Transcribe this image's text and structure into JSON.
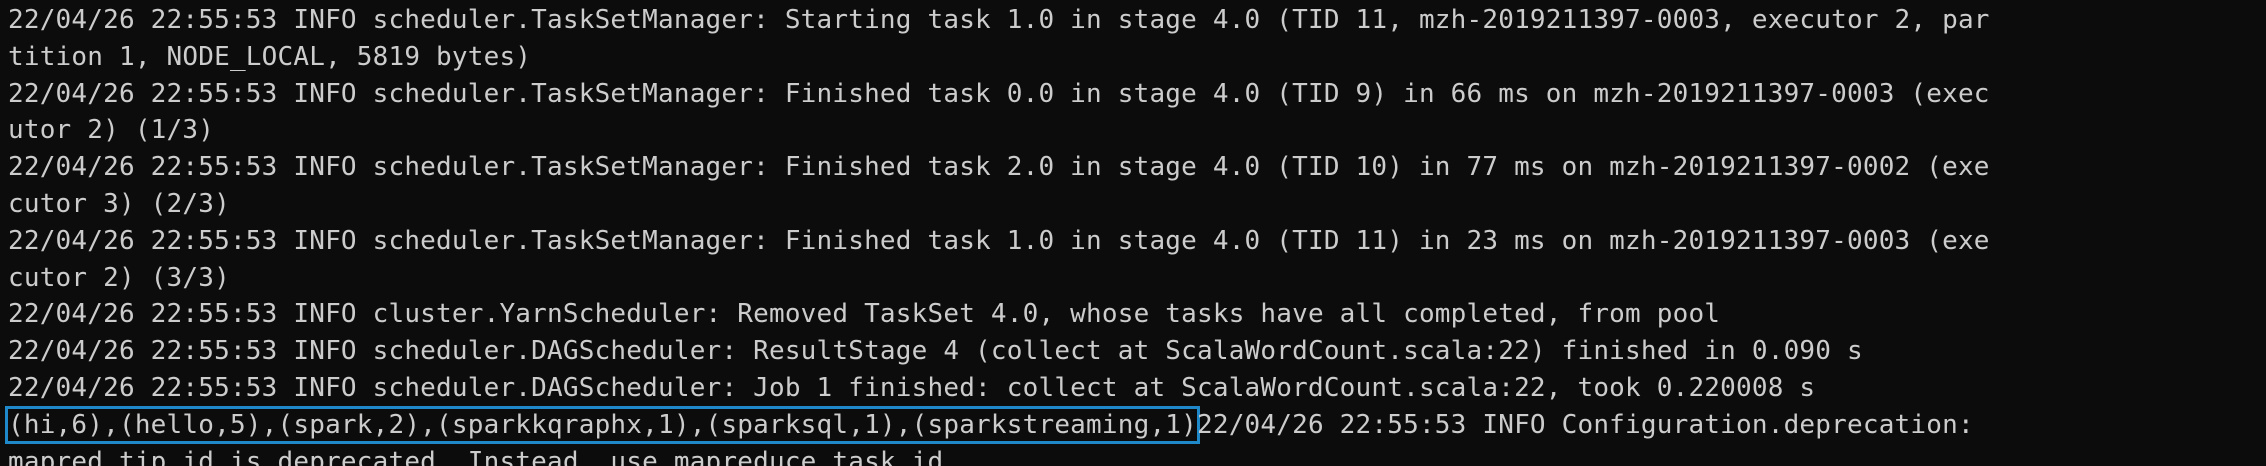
{
  "terminal": {
    "lines": [
      "22/04/26 22:55:53 INFO scheduler.TaskSetManager: Starting task 1.0 in stage 4.0 (TID 11, mzh-2019211397-0003, executor 2, par",
      "tition 1, NODE_LOCAL, 5819 bytes)",
      "22/04/26 22:55:53 INFO scheduler.TaskSetManager: Finished task 0.0 in stage 4.0 (TID 9) in 66 ms on mzh-2019211397-0003 (exec",
      "utor 2) (1/3)",
      "22/04/26 22:55:53 INFO scheduler.TaskSetManager: Finished task 2.0 in stage 4.0 (TID 10) in 77 ms on mzh-2019211397-0002 (exe",
      "cutor 3) (2/3)",
      "22/04/26 22:55:53 INFO scheduler.TaskSetManager: Finished task 1.0 in stage 4.0 (TID 11) in 23 ms on mzh-2019211397-0003 (exe",
      "cutor 2) (3/3)",
      "22/04/26 22:55:53 INFO cluster.YarnScheduler: Removed TaskSet 4.0, whose tasks have all completed, from pool",
      "22/04/26 22:55:53 INFO scheduler.DAGScheduler: ResultStage 4 (collect at ScalaWordCount.scala:22) finished in 0.090 s",
      "22/04/26 22:55:53 INFO scheduler.DAGScheduler: Job 1 finished: collect at ScalaWordCount.scala:22, took 0.220008 s"
    ],
    "result_line": {
      "highlighted": "(hi,6),(hello,5),(spark,2),(sparkkqraphx,1),(sparksql,1),(sparkstreaming,1)",
      "rest": "22/04/26 22:55:53 INFO Configuration.deprecation:"
    },
    "last_line": "mapred.tip.id is deprecated. Instead, use mapreduce.task.id",
    "colors": {
      "background": "#0c0c0c",
      "text": "#cccccc",
      "highlight_border": "#1e88c8"
    }
  }
}
